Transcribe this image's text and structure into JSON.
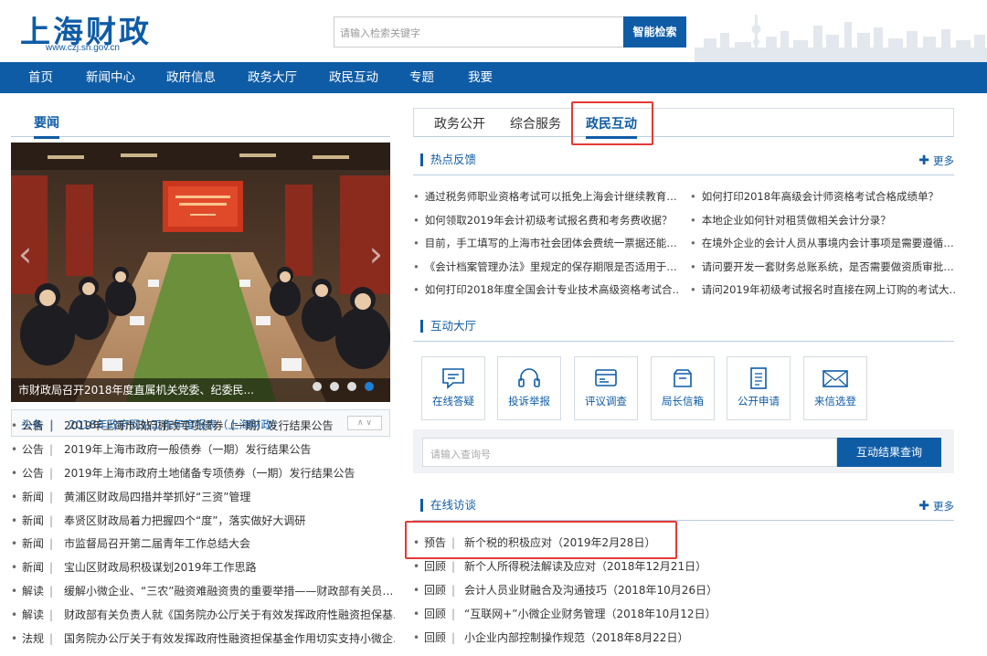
{
  "header": {
    "site_title": "上海财政",
    "site_url": "www.czj.sh.gov.cn",
    "search_placeholder": "请输入检索关键字",
    "search_button": "智能检索"
  },
  "nav": {
    "items": [
      "首页",
      "新闻中心",
      "政府信息",
      "政务大厅",
      "政民互动",
      "专题",
      "我要"
    ]
  },
  "news": {
    "section_title": "要闻",
    "photo_caption": "市财政局召开2018年度直属机关党委、纪委民...",
    "headline_tag": "头条",
    "headline_text": "2018年政府网站工作年度报表（上海财政）",
    "headline_arrows": "∧ ∨",
    "items": [
      {
        "cat": "公告",
        "text": "2019年上海市政府棚改专项债券（一期）发行结果公告"
      },
      {
        "cat": "公告",
        "text": "2019年上海市政府一般债券（一期）发行结果公告"
      },
      {
        "cat": "公告",
        "text": "2019年上海市政府土地储备专项债券（一期）发行结果公告"
      },
      {
        "cat": "新闻",
        "text": "黄浦区财政局四措并举抓好“三资”管理"
      },
      {
        "cat": "新闻",
        "text": "奉贤区财政局着力把握四个“度”，落实做好大调研"
      },
      {
        "cat": "新闻",
        "text": "市监督局召开第二届青年工作总结大会"
      },
      {
        "cat": "新闻",
        "text": "宝山区财政局积极谋划2019年工作思路"
      },
      {
        "cat": "解读",
        "text": "缓解小微企业、“三农”融资难融资贵的重要举措——财政部有关员…"
      },
      {
        "cat": "解读",
        "text": "财政部有关负责人就《国务院办公厅关于有效发挥政府性融资担保基…"
      },
      {
        "cat": "法规",
        "text": "国务院办公厅关于有效发挥政府性融资担保基金作用切实支持小微企…"
      }
    ]
  },
  "tabs": {
    "items": [
      "政务公开",
      "综合服务",
      "政民互动"
    ],
    "active": "政民互动"
  },
  "hot": {
    "title": "热点反馈",
    "more": "更多",
    "more_icon": "plus-icon",
    "left": [
      "通过税务师职业资格考试可以抵免上海会计继续教育…",
      "如何领取2019年会计初级考试报名费和考务费收据？",
      "目前，手工填写的上海市社会团体会费统一票据还能…",
      "《会计档案管理办法》里规定的保存期限是否适用于…",
      "如何打印2018年度全国会计专业技术高级资格考试合…"
    ],
    "right": [
      "如何打印2018年高级会计师资格考试合格成绩单？",
      "本地企业如何针对租赁做相关会计分录？",
      "在境外企业的会计人员从事境内会计事项是需要遵循…",
      "请问要开发一套财务总账系统，是否需要做资质审批…",
      "请问2019年初级考试报名时直接在网上订购的考试大…"
    ]
  },
  "hall": {
    "title": "互动大厅",
    "items": [
      {
        "label": "在线答疑",
        "icon": "chat-icon"
      },
      {
        "label": "投诉举报",
        "icon": "headset-icon"
      },
      {
        "label": "评议调查",
        "icon": "survey-card-icon"
      },
      {
        "label": "局长信箱",
        "icon": "mailbox-icon"
      },
      {
        "label": "公开申请",
        "icon": "document-icon"
      },
      {
        "label": "来信选登",
        "icon": "envelope-icon"
      }
    ],
    "query_placeholder": "请输入查询号",
    "query_button": "互动结果查询"
  },
  "interview": {
    "title": "在线访谈",
    "more": "更多",
    "items": [
      {
        "cat": "预告",
        "text": "新个税的积极应对（2019年2月28日）"
      },
      {
        "cat": "回顾",
        "text": "新个人所得税法解读及应对（2018年12月21日）"
      },
      {
        "cat": "回顾",
        "text": "会计人员业财融合及沟通技巧（2018年10月26日）"
      },
      {
        "cat": "回顾",
        "text": "“互联网+”小微企业财务管理（2018年10月12日）"
      },
      {
        "cat": "回顾",
        "text": "小企业内部控制操作规范（2018年8月22日）"
      }
    ]
  },
  "colors": {
    "brand_blue": "#0f5ca6",
    "highlight_red": "#e53935"
  }
}
